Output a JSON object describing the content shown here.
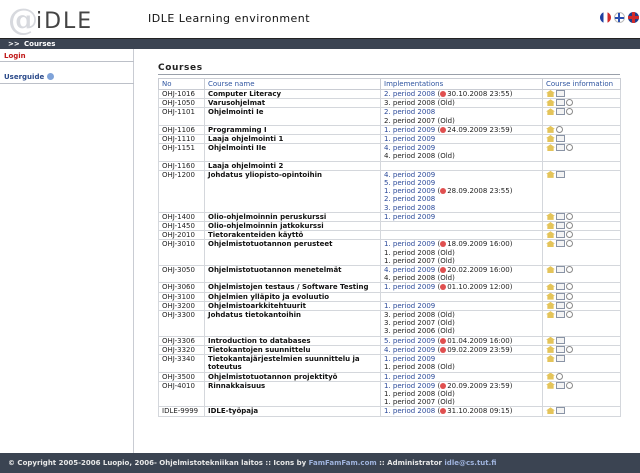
{
  "header": {
    "logo_text": "iDLE",
    "title": "IDLE Learning environment"
  },
  "breadcrumb": {
    "prefix": ">>",
    "current": "Courses"
  },
  "sidebar": {
    "login": "Login",
    "userguide": "Userguide"
  },
  "main": {
    "title": "Courses",
    "columns": [
      "No",
      "Course name",
      "Implementations",
      "Course information"
    ],
    "rows": [
      {
        "code": "OHJ-1016",
        "name": "Computer Literacy",
        "impl": [
          {
            "t": "2. period 2008",
            "c": true,
            "d": "30.10.2008 23:55)"
          }
        ],
        "icons": [
          "home",
          "mail"
        ]
      },
      {
        "code": "OHJ-1050",
        "name": "Varusohjelmat",
        "impl": [
          {
            "t": "3. period 2008 (Old)",
            "old": true
          }
        ],
        "icons": [
          "home",
          "mail",
          "clip"
        ]
      },
      {
        "code": "OHJ-1101",
        "name": "Ohjelmointi Ie",
        "impl": [
          {
            "t": "2. period 2008"
          },
          {
            "t": "2. period 2007 (Old)",
            "old": true
          }
        ],
        "icons": [
          "home",
          "mail",
          "clip"
        ]
      },
      {
        "code": "OHJ-1106",
        "name": "Programming I",
        "impl": [
          {
            "t": "1. period 2009",
            "c": true,
            "d": "24.09.2009 23:59)"
          }
        ],
        "icons": [
          "home",
          "clip"
        ]
      },
      {
        "code": "OHJ-1110",
        "name": "Laaja ohjelmointi 1",
        "impl": [
          {
            "t": "1. period 2009"
          }
        ],
        "icons": [
          "home",
          "mail"
        ]
      },
      {
        "code": "OHJ-1151",
        "name": "Ohjelmointi IIe",
        "impl": [
          {
            "t": "4. period 2009"
          },
          {
            "t": "4. period 2008 (Old)",
            "old": true
          }
        ],
        "icons": [
          "home",
          "mail",
          "clip"
        ]
      },
      {
        "code": "OHJ-1160",
        "name": "Laaja ohjelmointi 2",
        "impl": [],
        "icons": []
      },
      {
        "code": "OHJ-1200",
        "name": "Johdatus yliopisto-opintoihin",
        "impl": [
          {
            "t": "4. period 2009"
          },
          {
            "t": "5. period 2009"
          },
          {
            "t": "1. period 2009",
            "c": true,
            "d": "28.09.2008 23:55)"
          },
          {
            "t": "2. period 2008"
          },
          {
            "t": "3. period 2008"
          }
        ],
        "icons": [
          "home",
          "mail"
        ]
      },
      {
        "code": "OHJ-1400",
        "name": "Olio-ohjelmoinnin peruskurssi",
        "impl": [
          {
            "t": "1. period 2009"
          }
        ],
        "icons": [
          "home",
          "mail",
          "clip"
        ]
      },
      {
        "code": "OHJ-1450",
        "name": "Olio-ohjelmoinnin jatkokurssi",
        "impl": [],
        "icons": [
          "home",
          "mail",
          "clip"
        ]
      },
      {
        "code": "OHJ-2010",
        "name": "Tietorakenteiden käyttö",
        "impl": [],
        "icons": [
          "home",
          "mail",
          "clip"
        ]
      },
      {
        "code": "OHJ-3010",
        "name": "Ohjelmistotuotannon perusteet",
        "impl": [
          {
            "t": "1. period 2009",
            "c": true,
            "d": "18.09.2009 16:00)"
          },
          {
            "t": "1. period 2008 (Old)",
            "old": true
          },
          {
            "t": "1. period 2007 (Old)",
            "old": true
          }
        ],
        "icons": [
          "home",
          "mail",
          "clip"
        ]
      },
      {
        "code": "OHJ-3050",
        "name": "Ohjelmistotuotannon menetelmät",
        "impl": [
          {
            "t": "4. period 2009",
            "c": true,
            "d": "20.02.2009 16:00)"
          },
          {
            "t": "4. period 2008 (Old)",
            "old": true
          }
        ],
        "icons": [
          "home",
          "mail",
          "clip"
        ]
      },
      {
        "code": "OHJ-3060",
        "name": "Ohjelmistojen testaus / Software Testing",
        "impl": [
          {
            "t": "1. period 2009",
            "c": true,
            "d": "01.10.2009 12:00)"
          }
        ],
        "icons": [
          "home",
          "mail",
          "clip"
        ]
      },
      {
        "code": "OHJ-3100",
        "name": "Ohjelmien ylläpito ja evoluutio",
        "impl": [],
        "icons": [
          "home",
          "mail",
          "clip"
        ]
      },
      {
        "code": "OHJ-3200",
        "name": "Ohjelmistoarkkitehtuurit",
        "impl": [
          {
            "t": "1. period 2009"
          }
        ],
        "icons": [
          "home",
          "mail",
          "clip"
        ]
      },
      {
        "code": "OHJ-3300",
        "name": "Johdatus tietokantoihin",
        "impl": [
          {
            "t": "3. period 2008 (Old)",
            "old": true
          },
          {
            "t": "3. period 2007 (Old)",
            "old": true
          },
          {
            "t": "3. period 2006 (Old)",
            "old": true
          }
        ],
        "icons": [
          "home",
          "mail",
          "clip"
        ]
      },
      {
        "code": "OHJ-3306",
        "name": "Introduction to databases",
        "impl": [
          {
            "t": "5. period 2009",
            "c": true,
            "d": "01.04.2009 16:00)"
          }
        ],
        "icons": [
          "home",
          "mail"
        ]
      },
      {
        "code": "OHJ-3320",
        "name": "Tietokantojen suunnittelu",
        "impl": [
          {
            "t": "4. period 2009",
            "c": true,
            "d": "09.02.2009 23:59)"
          }
        ],
        "icons": [
          "home",
          "mail",
          "clip"
        ]
      },
      {
        "code": "OHJ-3340",
        "name": "Tietokantajärjestelmien suunnittelu ja toteutus",
        "impl": [
          {
            "t": "1. period 2009"
          },
          {
            "t": "1. period 2008 (Old)",
            "old": true
          }
        ],
        "icons": [
          "home",
          "mail"
        ]
      },
      {
        "code": "OHJ-3500",
        "name": "Ohjelmistotuotannon projektityö",
        "impl": [
          {
            "t": "1. period 2009"
          }
        ],
        "icons": [
          "home",
          "clip"
        ]
      },
      {
        "code": "OHJ-4010",
        "name": "Rinnakkaisuus",
        "impl": [
          {
            "t": "1. period 2009",
            "c": true,
            "d": "20.09.2009 23:59)"
          },
          {
            "t": "1. period 2008 (Old)",
            "old": true
          },
          {
            "t": "1. period 2007 (Old)",
            "old": true
          }
        ],
        "icons": [
          "home",
          "mail",
          "clip"
        ]
      },
      {
        "code": "IDLE-9999",
        "name": "IDLE-työpaja",
        "impl": [
          {
            "t": "1. period 2008",
            "c": true,
            "d": "31.10.2008 09:15)"
          }
        ],
        "icons": [
          "home",
          "mail"
        ]
      }
    ]
  },
  "footer": {
    "text_a": "© Copyright 2005-2006 Luopio, 2006- Ohjelmistotekniikan laitos :: Icons by ",
    "icons_link": "FamFamFam.com",
    "text_b": " :: Administrator ",
    "admin_email": "idle@cs.tut.fi"
  },
  "colors": {
    "accent": "#2b4a9a",
    "bar": "#3b4452",
    "login": "#c01818"
  }
}
